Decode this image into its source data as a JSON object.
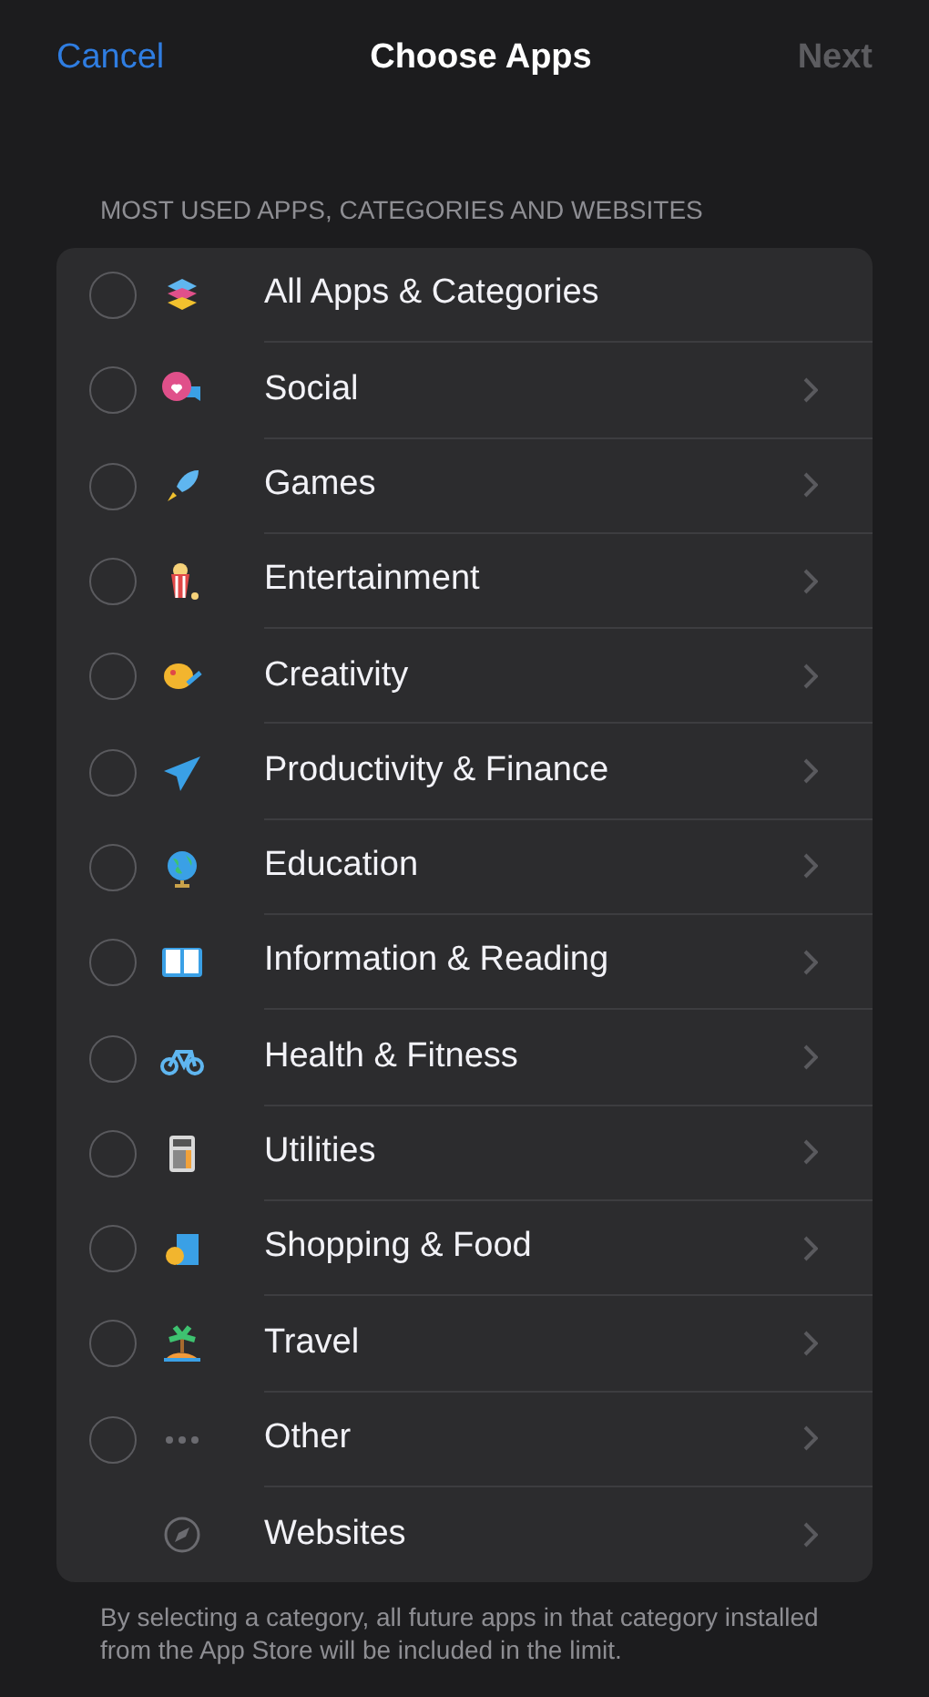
{
  "nav": {
    "cancel": "Cancel",
    "title": "Choose Apps",
    "next": {
      "label": "Next",
      "disabled": true
    }
  },
  "section_header": "MOST USED APPS, CATEGORIES AND WEBSITES",
  "items": [
    {
      "kind": "category",
      "label": "All Apps & Categories",
      "checked": false,
      "disclosure": false
    },
    {
      "kind": "category",
      "label": "Social",
      "checked": false,
      "disclosure": true
    },
    {
      "kind": "category",
      "label": "Games",
      "checked": false,
      "disclosure": true
    },
    {
      "kind": "category",
      "label": "Entertainment",
      "checked": false,
      "disclosure": true
    },
    {
      "kind": "category",
      "label": "Creativity",
      "checked": false,
      "disclosure": true
    },
    {
      "kind": "category",
      "label": "Productivity & Finance",
      "checked": false,
      "disclosure": true
    },
    {
      "kind": "category",
      "label": "Education",
      "checked": false,
      "disclosure": true
    },
    {
      "kind": "category",
      "label": "Information & Reading",
      "checked": false,
      "disclosure": true
    },
    {
      "kind": "category",
      "label": "Health & Fitness",
      "checked": false,
      "disclosure": true
    },
    {
      "kind": "category",
      "label": "Utilities",
      "checked": false,
      "disclosure": true
    },
    {
      "kind": "category",
      "label": "Shopping & Food",
      "checked": false,
      "disclosure": true
    },
    {
      "kind": "category",
      "label": "Travel",
      "checked": false,
      "disclosure": true
    },
    {
      "kind": "category",
      "label": "Other",
      "checked": false,
      "disclosure": true
    },
    {
      "kind": "link",
      "label": "Websites",
      "disclosure": true
    }
  ],
  "footer": "By selecting a category, all future apps in that category installed from the App Store will be included in the limit."
}
